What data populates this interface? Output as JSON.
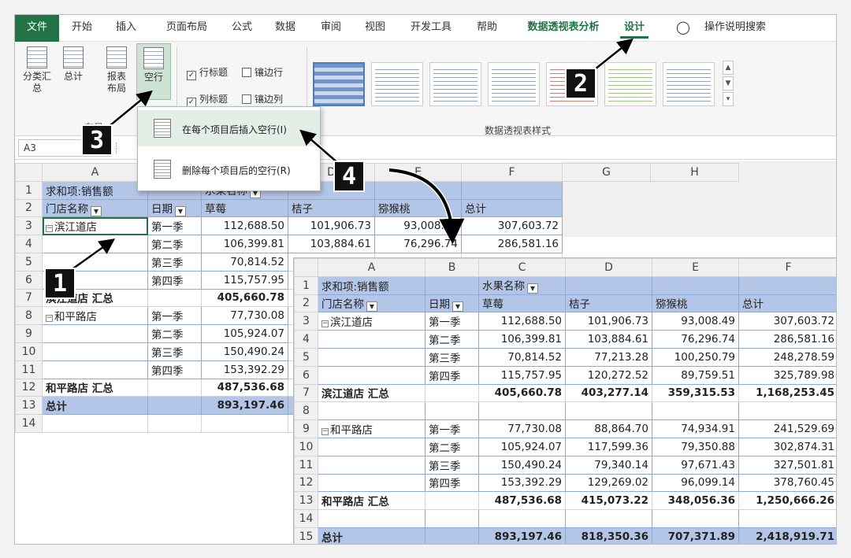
{
  "tabs": [
    "文件",
    "开始",
    "插入",
    "页面布局",
    "公式",
    "数据",
    "审阅",
    "视图",
    "开发工具",
    "帮助",
    "数据透视表分析",
    "设计"
  ],
  "tell_me": "操作说明搜索",
  "ribbon": {
    "subtotals": "分类汇总",
    "grand_totals": "总计",
    "report_layout": "报表布局",
    "blank_rows": "空行",
    "group_layout": "布局",
    "row_headers": "行标题",
    "banded_rows": "镶边行",
    "col_headers": "列标题",
    "banded_cols": "镶边列",
    "group_styles": "数据透视表样式"
  },
  "menu": {
    "insert_blank": "在每个项目后插入空行(I)",
    "remove_blank": "删除每个项目后的空行(R)"
  },
  "name_box": "A3",
  "badges": [
    "1",
    "2",
    "3",
    "4"
  ],
  "left_table": {
    "col_letters": [
      "A",
      "B",
      "C",
      "D",
      "E",
      "F",
      "G",
      "H"
    ],
    "sum_label": "求和项:销售额",
    "fruit_label": "水果名称",
    "store_label": "门店名称",
    "date_label": "日期",
    "fruits": [
      "草莓",
      "桔子",
      "猕猴桃",
      "总计"
    ],
    "rows": [
      {
        "n": "3",
        "store": "滨江道店",
        "q": "第一季",
        "c": "112,688.50",
        "d": "101,906.73",
        "e": "93,008.49",
        "f": "307,603.72"
      },
      {
        "n": "4",
        "store": "",
        "q": "第二季",
        "c": "106,399.81",
        "d": "103,884.61",
        "e": "76,296.74",
        "f": "286,581.16"
      },
      {
        "n": "5",
        "store": "",
        "q": "第三季",
        "c": "70,814.52"
      },
      {
        "n": "6",
        "store": "",
        "q": "第四季",
        "c": "115,757.95"
      },
      {
        "n": "7",
        "subtotal": "滨江道店 汇总",
        "c": "405,660.78"
      },
      {
        "n": "8",
        "store": "和平路店",
        "q": "第一季",
        "c": "77,730.08"
      },
      {
        "n": "9",
        "store": "",
        "q": "第二季",
        "c": "105,924.07"
      },
      {
        "n": "10",
        "store": "",
        "q": "第三季",
        "c": "150,490.24"
      },
      {
        "n": "11",
        "store": "",
        "q": "第四季",
        "c": "153,392.29"
      },
      {
        "n": "12",
        "subtotal": "和平路店 汇总",
        "c": "487,536.68"
      },
      {
        "n": "13",
        "total": "总计",
        "c": "893,197.46"
      },
      {
        "n": "14"
      }
    ]
  },
  "right_table": {
    "col_letters": [
      "A",
      "B",
      "C",
      "D",
      "E",
      "F"
    ],
    "sum_label": "求和项:销售额",
    "fruit_label": "水果名称",
    "store_label": "门店名称",
    "date_label": "日期",
    "fruits": [
      "草莓",
      "桔子",
      "猕猴桃",
      "总计"
    ],
    "rows": [
      {
        "n": "3",
        "store": "滨江道店",
        "q": "第一季",
        "c": "112,688.50",
        "d": "101,906.73",
        "e": "93,008.49",
        "f": "307,603.72"
      },
      {
        "n": "4",
        "store": "",
        "q": "第二季",
        "c": "106,399.81",
        "d": "103,884.61",
        "e": "76,296.74",
        "f": "286,581.16"
      },
      {
        "n": "5",
        "store": "",
        "q": "第三季",
        "c": "70,814.52",
        "d": "77,213.28",
        "e": "100,250.79",
        "f": "248,278.59"
      },
      {
        "n": "6",
        "store": "",
        "q": "第四季",
        "c": "115,757.95",
        "d": "120,272.52",
        "e": "89,759.51",
        "f": "325,789.98"
      },
      {
        "n": "7",
        "subtotal": "滨江道店 汇总",
        "c": "405,660.78",
        "d": "403,277.14",
        "e": "359,315.53",
        "f": "1,168,253.45"
      },
      {
        "n": "8",
        "blank": true
      },
      {
        "n": "9",
        "store": "和平路店",
        "q": "第一季",
        "c": "77,730.08",
        "d": "88,864.70",
        "e": "74,934.91",
        "f": "241,529.69"
      },
      {
        "n": "10",
        "store": "",
        "q": "第二季",
        "c": "105,924.07",
        "d": "117,599.36",
        "e": "79,350.88",
        "f": "302,874.31"
      },
      {
        "n": "11",
        "store": "",
        "q": "第三季",
        "c": "150,490.24",
        "d": "79,340.14",
        "e": "97,671.43",
        "f": "327,501.81"
      },
      {
        "n": "12",
        "store": "",
        "q": "第四季",
        "c": "153,392.29",
        "d": "129,269.02",
        "e": "96,099.14",
        "f": "378,760.45"
      },
      {
        "n": "13",
        "subtotal": "和平路店 汇总",
        "c": "487,536.68",
        "d": "415,073.22",
        "e": "348,056.36",
        "f": "1,250,666.26"
      },
      {
        "n": "14",
        "blank": true
      },
      {
        "n": "15",
        "total": "总计",
        "c": "893,197.46",
        "d": "818,350.36",
        "e": "707,371.89",
        "f": "2,418,919.71"
      }
    ]
  }
}
